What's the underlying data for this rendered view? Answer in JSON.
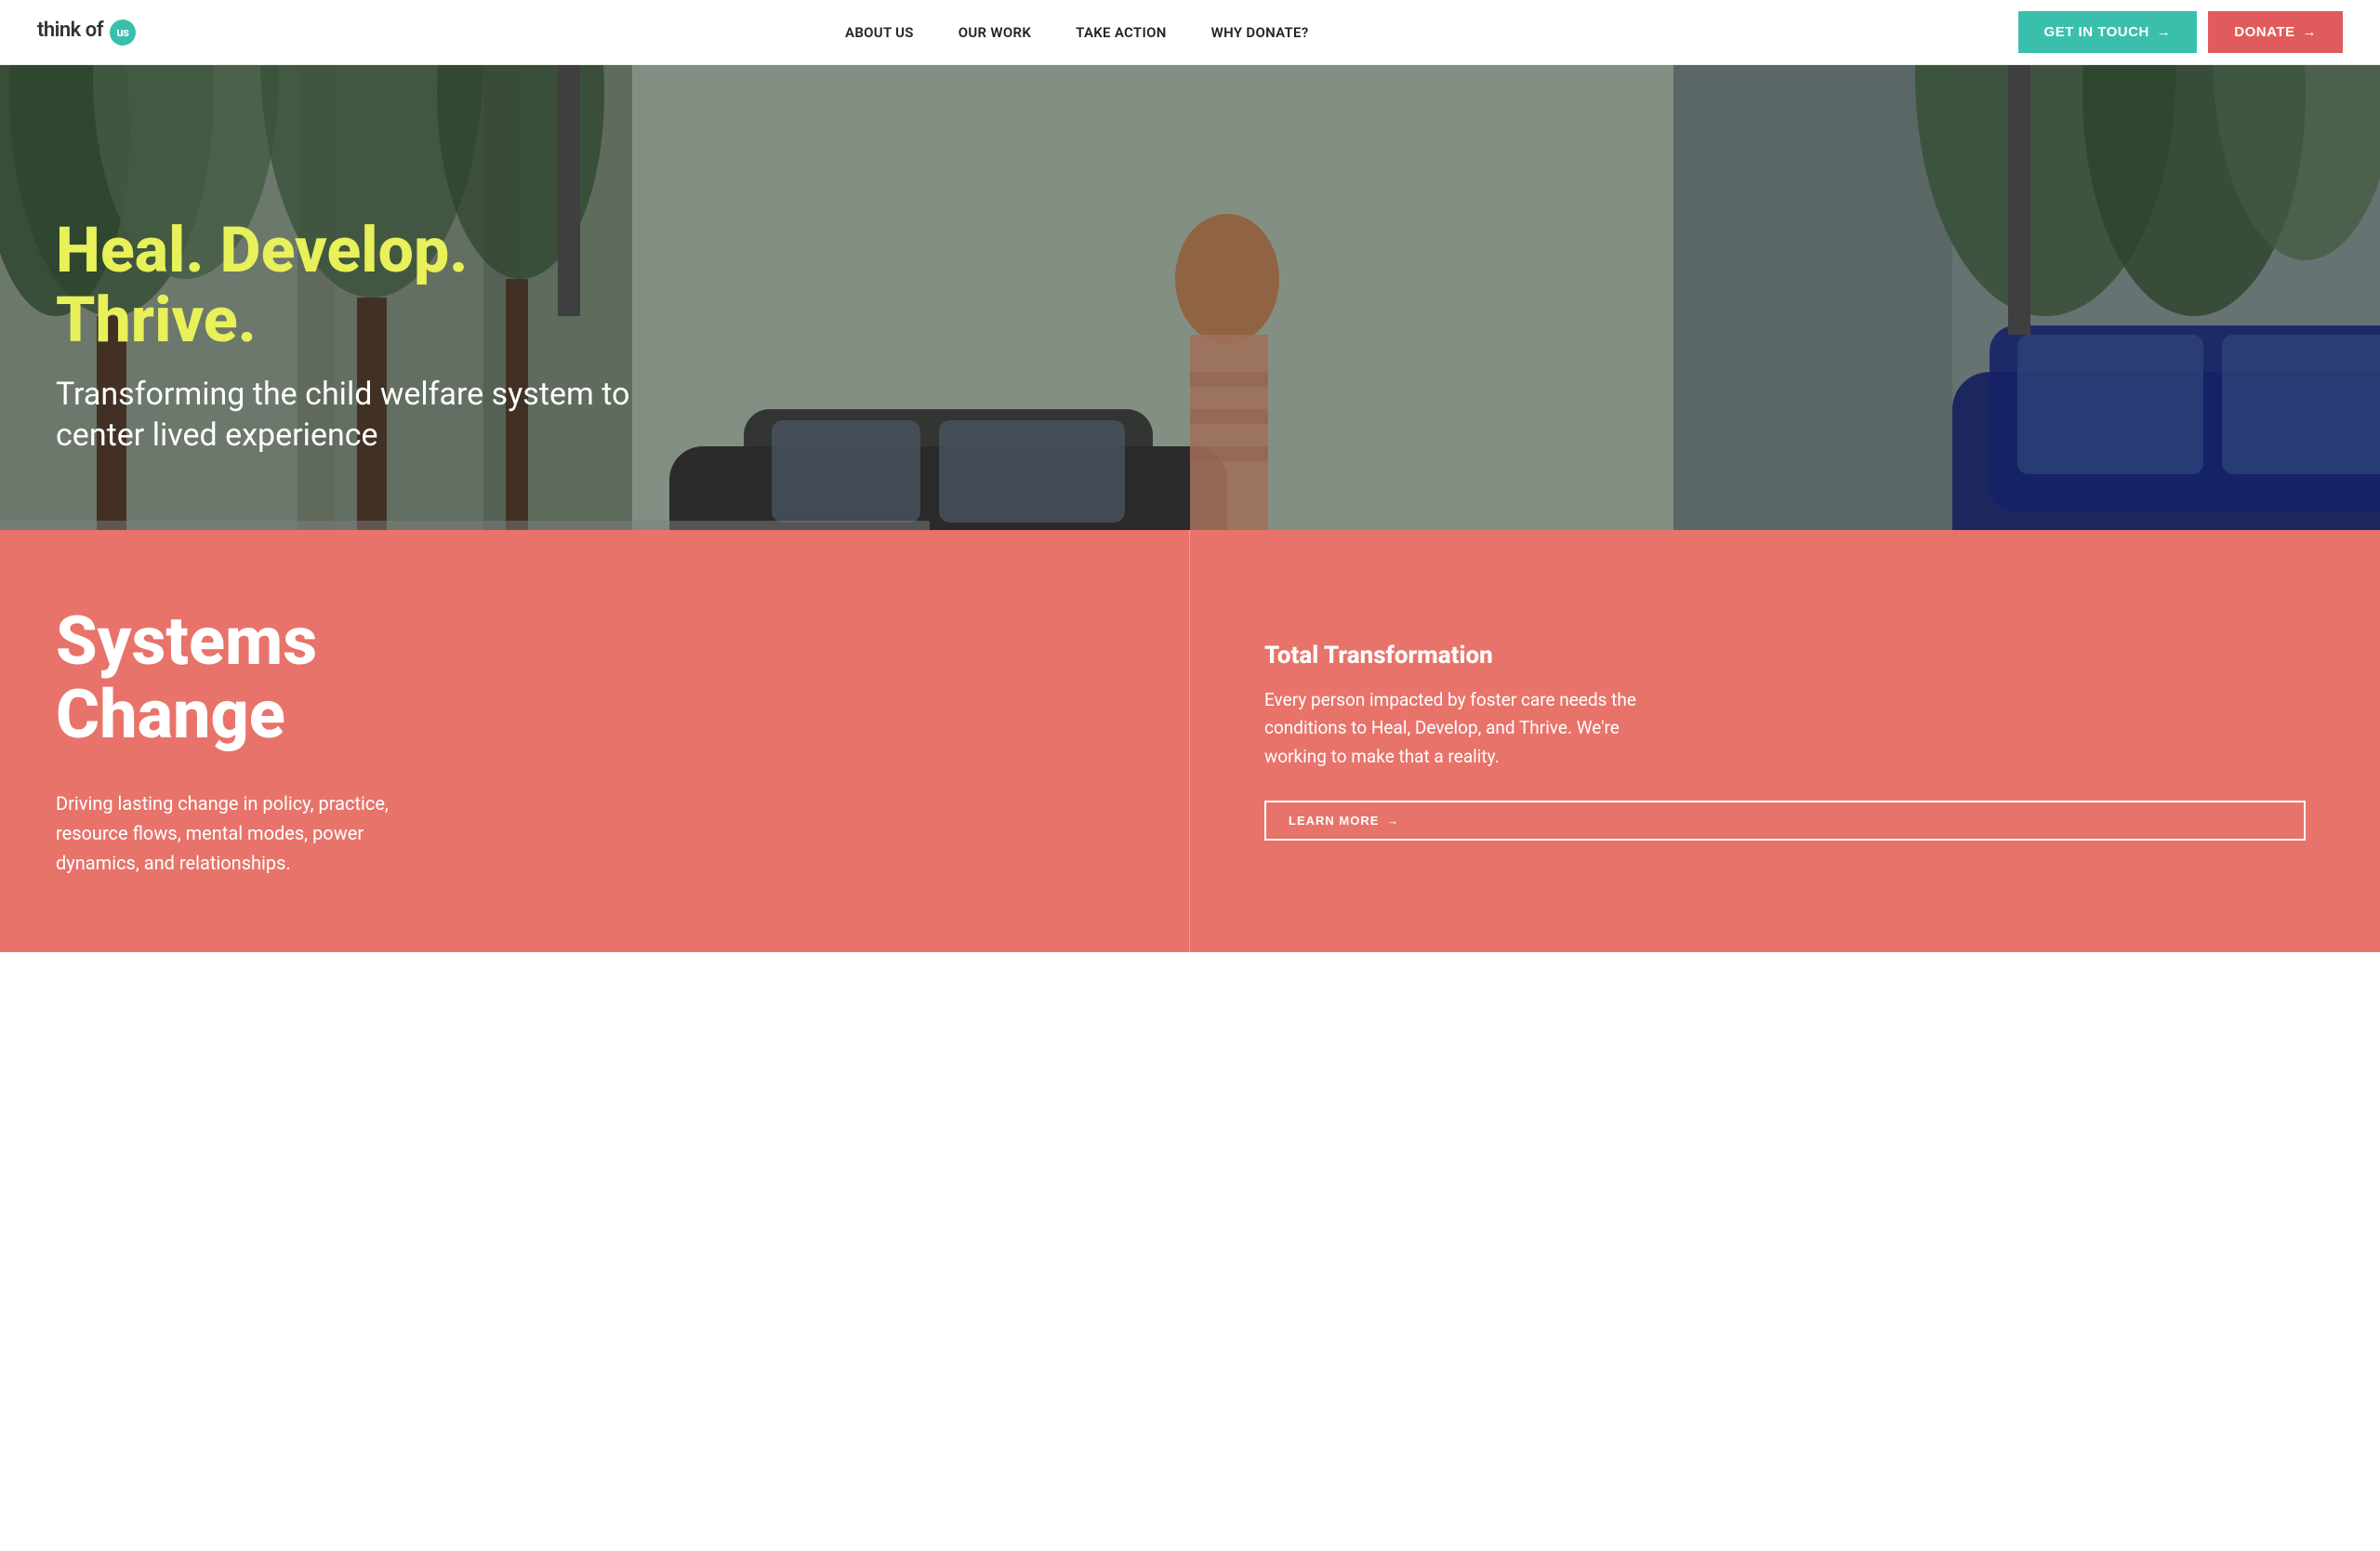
{
  "header": {
    "logo": {
      "text_before": "think of ",
      "badge": "us"
    },
    "nav": {
      "items": [
        {
          "label": "ABOUT US",
          "id": "about-us"
        },
        {
          "label": "OUR WORK",
          "id": "our-work"
        },
        {
          "label": "TAKE ACTION",
          "id": "take-action"
        },
        {
          "label": "WHY DONATE?",
          "id": "why-donate"
        }
      ]
    },
    "cta_primary": {
      "label": "GET IN TOUCH",
      "arrow": "→"
    },
    "cta_secondary": {
      "label": "DONATE",
      "arrow": "→"
    }
  },
  "hero": {
    "title": "Heal. Develop. Thrive.",
    "subtitle": "Transforming the child welfare system to center lived experience"
  },
  "lower": {
    "left": {
      "title_line1": "Systems",
      "title_line2": "Change",
      "description": "Driving lasting change in policy, practice, resource flows, mental modes, power dynamics, and relationships."
    },
    "right": {
      "title": "Total Transformation",
      "description": "Every person impacted by foster care needs the conditions to Heal, Develop, and Thrive. We're working to make that a reality.",
      "cta_label": "LEARN MORE",
      "cta_arrow": "→"
    }
  },
  "colors": {
    "teal": "#3bbfad",
    "coral": "#e8736a",
    "red_button": "#e05c5c",
    "yellow_hero": "#e8f05a",
    "white": "#ffffff"
  }
}
